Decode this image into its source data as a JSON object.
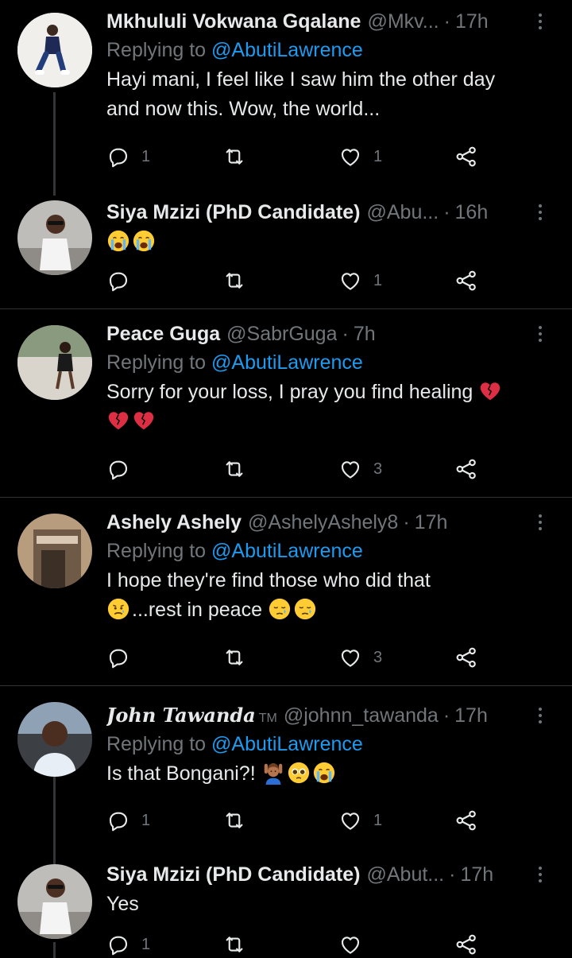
{
  "tweets": [
    {
      "name": "Mkhululi Vokwana Gqalane",
      "handle": "@Mkv...",
      "time": "17h",
      "replying_prefix": "Replying to",
      "replying_to": "@AbutiLawrence",
      "text_lines": [
        "Hayi mani, I feel like I saw him the other day",
        "and now this. Wow, the world..."
      ],
      "replies": "1",
      "retweets": "",
      "likes": "1"
    },
    {
      "name": "Siya Mzizi (PhD Candidate)",
      "handle": "@Abu...",
      "time": "16h",
      "emojis": [
        "loudly-crying-face",
        "loudly-crying-face"
      ],
      "replies": "",
      "retweets": "",
      "likes": "1"
    },
    {
      "name": "Peace Guga",
      "handle": "@SabrGuga",
      "time": "7h",
      "replying_prefix": "Replying to",
      "replying_to": "@AbutiLawrence",
      "text_lines": [
        "Sorry for your loss, I pray you find healing"
      ],
      "emojis": [
        "broken-heart",
        "broken-heart",
        "broken-heart"
      ],
      "replies": "",
      "retweets": "",
      "likes": "3"
    },
    {
      "name": "Ashely Ashely",
      "handle": "@AshelyAshely8",
      "time": "17h",
      "replying_prefix": "Replying to",
      "replying_to": "@AbutiLawrence",
      "text_lines": [
        "I hope they're find those who did that",
        "...rest in peace"
      ],
      "emojis": [
        "sad-relieved-face",
        "sad-sleepy-face",
        "sad-sleepy-face"
      ],
      "replies": "",
      "retweets": "",
      "likes": "3"
    },
    {
      "name": "John Tawanda",
      "name_suffix": "TM",
      "handle": "@johnn_tawanda",
      "time": "17h",
      "replying_prefix": "Replying to",
      "replying_to": "@AbutiLawrence",
      "text_lines": [
        "Is that Bongani?!"
      ],
      "emojis": [
        "person-raising-hands",
        "pleading-face",
        "loudly-crying-face"
      ],
      "replies": "1",
      "retweets": "",
      "likes": "1"
    },
    {
      "name": "Siya Mzizi (PhD Candidate)",
      "handle": "@Abut...",
      "time": "17h",
      "text_lines": [
        "Yes"
      ],
      "replies": "1",
      "retweets": "",
      "likes": ""
    }
  ],
  "separator": "·",
  "colors": {
    "background": "#000000",
    "text": "#e7e9ea",
    "muted": "#71767b",
    "link": "#1d9bf0",
    "divider": "#2f3336"
  },
  "icons": [
    "reply-icon",
    "retweet-icon",
    "like-icon",
    "share-icon",
    "more-icon"
  ]
}
